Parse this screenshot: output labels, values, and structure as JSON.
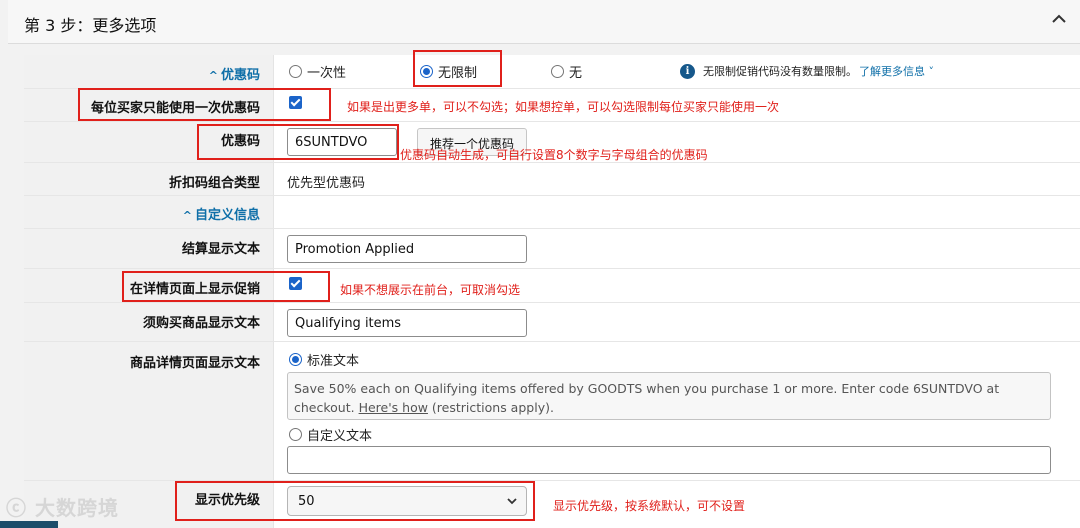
{
  "header": {
    "title": "第 3 步：更多选项",
    "collapse_icon": "chevron-up-icon"
  },
  "coupon": {
    "label": "优惠码",
    "options": [
      "一次性",
      "无限制",
      "无"
    ],
    "selected": "无限制",
    "info_text": "无限制促销代码没有数量限制。",
    "info_link": "了解更多信息"
  },
  "one_per_buyer": {
    "label": "每位买家只能使用一次优惠码",
    "checked": true,
    "note": "如果是出更多单，可以不勾选；如果想控单，可以勾选限制每位买家只能使用一次"
  },
  "coupon_code": {
    "label": "优惠码",
    "value": "6SUNTDVO",
    "suggest_button": "推荐一个优惠码",
    "note": "优惠码自动生成，可自行设置8个数字与字母组合的优惠码"
  },
  "combination": {
    "label": "折扣码组合类型",
    "value": "优先型优惠码"
  },
  "custom_info": {
    "label": "自定义信息"
  },
  "checkout_text": {
    "label": "结算显示文本",
    "value": "Promotion Applied"
  },
  "show_on_detail": {
    "label": "在详情页面上显示促销",
    "checked": true,
    "note": "如果不想展示在前台，可取消勾选"
  },
  "qualifying_text": {
    "label": "须购买商品显示文本",
    "value": "Qualifying items"
  },
  "detail_text": {
    "label": "商品详情页面显示文本",
    "standard_option": "标准文本",
    "standard_text_1": "Save 50% each on Qualifying items offered by GOODTS when you purchase 1 or more. Enter code 6SUNTDVO at",
    "standard_text_2a": "checkout. ",
    "standard_text_link": "Here's how",
    "standard_text_2b": " (restrictions apply).",
    "custom_option": "自定义文本",
    "custom_value": ""
  },
  "priority": {
    "label": "显示优先级",
    "value": "50",
    "note": "显示优先级，按系统默认，可不设置"
  },
  "watermark": "大数跨境",
  "colors": {
    "accent": "#1b64c9",
    "annotation": "#e0201b",
    "link": "#0f6fa8"
  }
}
